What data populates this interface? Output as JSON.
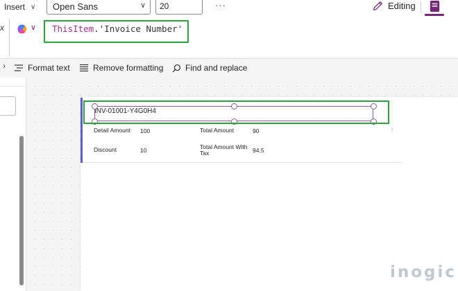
{
  "toolbar": {
    "insert_label": "Insert",
    "font_family_value": "Open Sans",
    "font_size_value": "20",
    "more_label": "···",
    "editing_label": "Editing"
  },
  "formula_bar": {
    "fx_label": "x",
    "keyword": "ThisItem",
    "rest": ".'Invoice Number'"
  },
  "format_bar": {
    "format_text": "Format text",
    "remove_formatting": "Remove formatting",
    "find_replace": "Find and replace"
  },
  "gallery": {
    "invoice_number": "INV-01001-Y4G0H4",
    "detail_amount_label": "Detail Amount",
    "detail_amount_value": "100",
    "total_amount_label": "Total Amount",
    "total_amount_value": "90",
    "discount_label": "Discount",
    "discount_value": "10",
    "total_with_tax_label_line1": "Total Amount With",
    "total_with_tax_label_line2": "Tax",
    "total_with_tax_value": "94.5"
  },
  "watermark": "inogic",
  "colors": {
    "highlight_green": "#2aa33c",
    "accent_purple": "#742774",
    "keyword_magenta": "#a02f8c",
    "selection_purple": "#8f5a9c",
    "row_accent_blue": "#5b5fc7"
  }
}
